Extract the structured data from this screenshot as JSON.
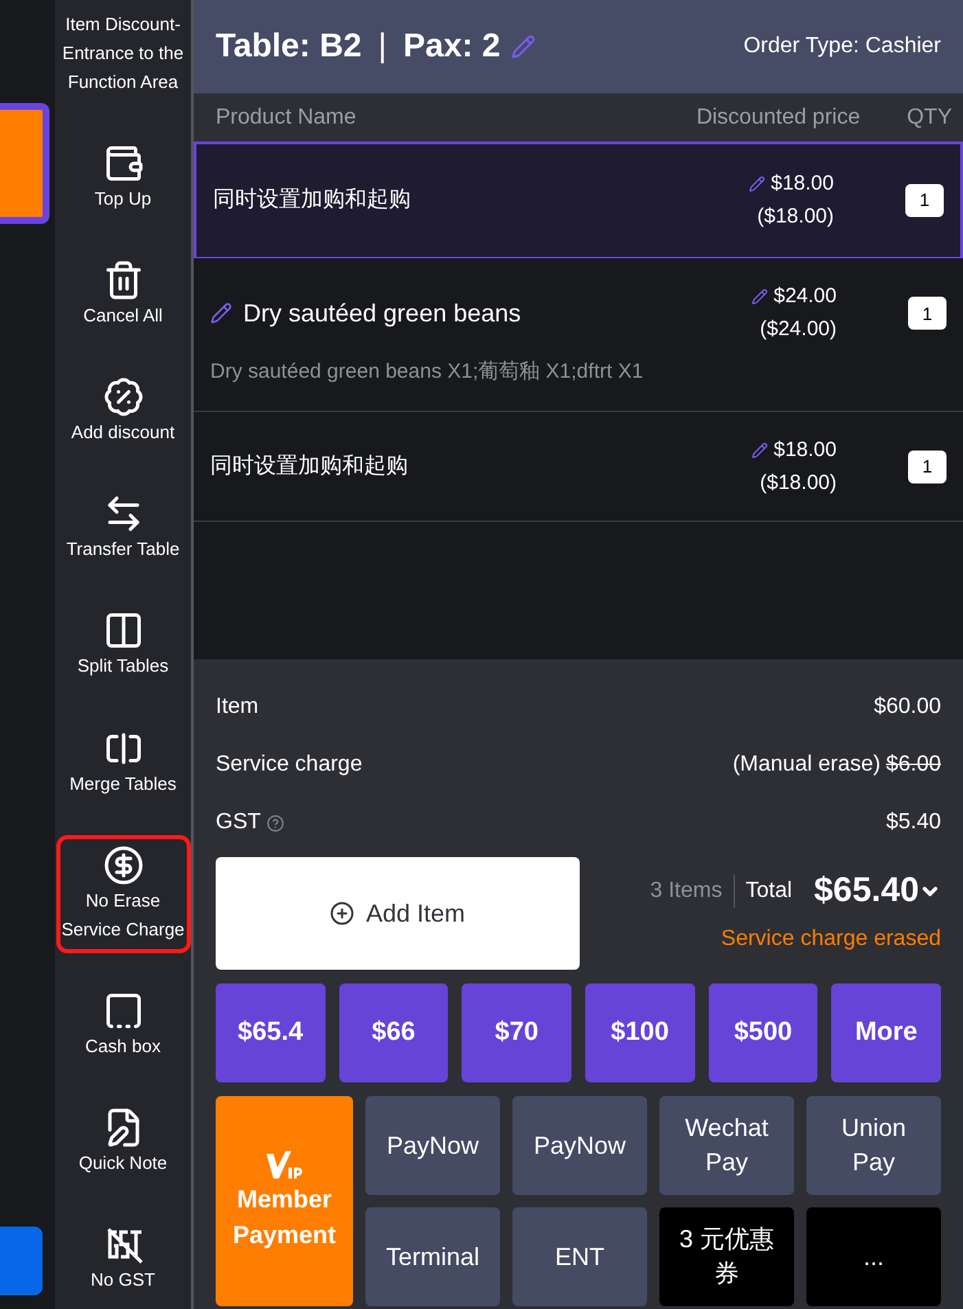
{
  "sidebar": {
    "items": [
      {
        "label": "Item Discount-Entrance to the Function Area",
        "highlighted": false
      },
      {
        "label": "Top Up",
        "highlighted": false
      },
      {
        "label": "Cancel All",
        "highlighted": false
      },
      {
        "label": "Add discount",
        "highlighted": false
      },
      {
        "label": "Transfer Table",
        "highlighted": false
      },
      {
        "label": "Split Tables",
        "highlighted": false
      },
      {
        "label": "Merge Tables",
        "highlighted": false
      },
      {
        "label": "No Erase Service Charge",
        "highlighted": true
      },
      {
        "label": "Cash box",
        "highlighted": false
      },
      {
        "label": "Quick Note",
        "highlighted": false
      },
      {
        "label": "No GST",
        "highlighted": false
      }
    ]
  },
  "header": {
    "table": "Table: B2",
    "pax": "Pax: 2",
    "separator": "|",
    "order_type": "Order Type: Cashier"
  },
  "table": {
    "columns": [
      "Product Name",
      "Discounted price",
      "QTY"
    ],
    "rows": [
      {
        "name": "同时设置加购和起购",
        "name_edited": false,
        "price": "$18.00",
        "original_price": "($18.00)",
        "qty": "1",
        "selected": true
      },
      {
        "name": "Dry sautéed green beans",
        "name_edited": true,
        "note": "Dry sautéed green beans X1;葡萄釉 X1;dftrt X1",
        "price": "$24.00",
        "original_price": "($24.00)",
        "qty": "1",
        "selected": false
      },
      {
        "name": "同时设置加购和起购",
        "name_edited": false,
        "price": "$18.00",
        "original_price": "($18.00)",
        "qty": "1",
        "selected": false
      }
    ]
  },
  "summary": {
    "lines": [
      {
        "label": "Item",
        "value": "$60.00",
        "struck": false,
        "help": false
      },
      {
        "label": "Service charge",
        "note": "(Manual erase)",
        "value": "$6.00",
        "struck": true,
        "help": false
      },
      {
        "label": "GST",
        "value": "$5.40",
        "struck": false,
        "help": true
      }
    ],
    "add_item": "Add Item",
    "count": "3 Items",
    "total_label": "Total",
    "total": "$65.40",
    "notice": "Service charge erased"
  },
  "quick_amounts": [
    "$65.4",
    "$66",
    "$70",
    "$100",
    "$500",
    "More"
  ],
  "payment_methods": [
    {
      "label": "Member Payment",
      "kind": "member"
    },
    {
      "label": "PayNow",
      "kind": "method"
    },
    {
      "label": "PayNow",
      "kind": "method"
    },
    {
      "label": "Wechat Pay",
      "kind": "method"
    },
    {
      "label": "Union Pay",
      "kind": "method"
    },
    {
      "label": "Terminal",
      "kind": "method"
    },
    {
      "label": "ENT",
      "kind": "method"
    },
    {
      "label": "3 元优惠券",
      "kind": "voucher"
    },
    {
      "label": "...",
      "kind": "voucher"
    }
  ]
}
